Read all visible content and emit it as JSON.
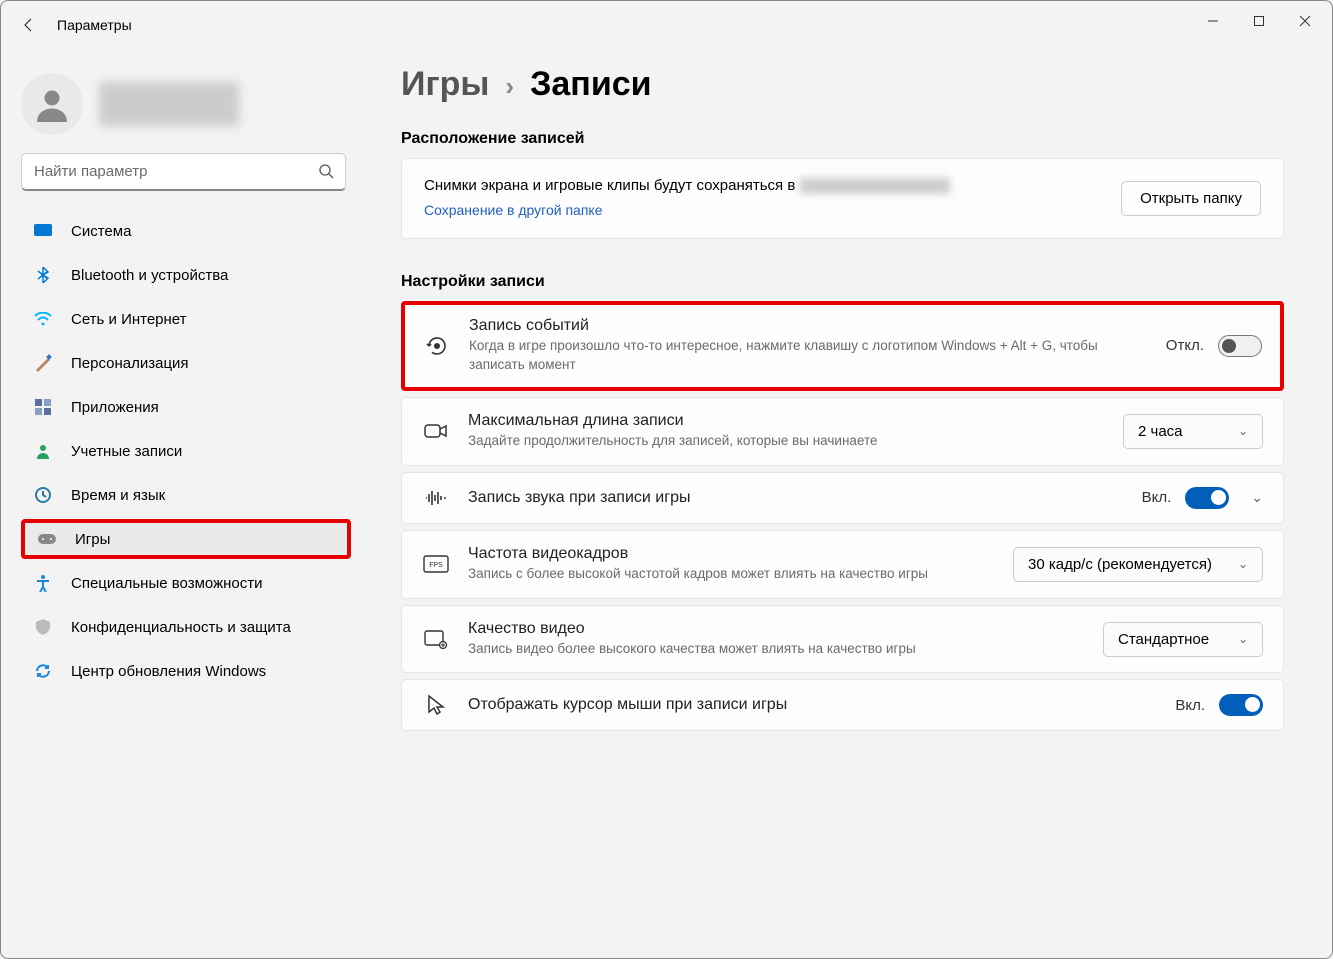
{
  "window": {
    "title": "Параметры"
  },
  "search": {
    "placeholder": "Найти параметр"
  },
  "nav": {
    "items": [
      {
        "label": "Система",
        "icon": "system",
        "color": "#0078d4"
      },
      {
        "label": "Bluetooth и устройства",
        "icon": "bluetooth",
        "color": "#0078d4"
      },
      {
        "label": "Сеть и Интернет",
        "icon": "wifi",
        "color": "#00b7ff"
      },
      {
        "label": "Персонализация",
        "icon": "brush",
        "color": "#c0825a"
      },
      {
        "label": "Приложения",
        "icon": "apps",
        "color": "#5a6fa0"
      },
      {
        "label": "Учетные записи",
        "icon": "account",
        "color": "#2aa060"
      },
      {
        "label": "Время и язык",
        "icon": "time",
        "color": "#2a80a0"
      },
      {
        "label": "Игры",
        "icon": "gaming",
        "color": "#888",
        "selected": true,
        "highlighted": true
      },
      {
        "label": "Специальные возможности",
        "icon": "accessibility",
        "color": "#1a88e0"
      },
      {
        "label": "Конфиденциальность и защита",
        "icon": "privacy",
        "color": "#888"
      },
      {
        "label": "Центр обновления Windows",
        "icon": "update",
        "color": "#1a88e0"
      }
    ]
  },
  "breadcrumb": {
    "parent": "Игры",
    "current": "Записи"
  },
  "sections": {
    "location_heading": "Расположение записей",
    "recording_heading": "Настройки записи"
  },
  "location": {
    "text": "Снимки экрана и игровые клипы будут сохраняться в",
    "link": "Сохранение в другой папке",
    "button": "Открыть папку"
  },
  "rows": {
    "capture": {
      "title": "Запись событий",
      "sub": "Когда в игре произошло что-то интересное, нажмите клавишу с логотипом Windows + Alt + G, чтобы записать момент",
      "state_label": "Откл.",
      "state": "off",
      "highlighted": true
    },
    "maxlen": {
      "title": "Максимальная длина записи",
      "sub": "Задайте продолжительность для записей, которые вы начинаете",
      "value": "2 часа"
    },
    "audio": {
      "title": "Запись звука при записи игры",
      "state_label": "Вкл.",
      "state": "on",
      "expandable": true
    },
    "fps": {
      "title": "Частота видеокадров",
      "sub": "Запись с более высокой частотой кадров может влиять на качество игры",
      "value": "30 кадр/с (рекомендуется)"
    },
    "quality": {
      "title": "Качество видео",
      "sub": "Запись видео более высокого качества может влиять на качество игры",
      "value": "Стандартное"
    },
    "cursor": {
      "title": "Отображать курсор мыши при записи игры",
      "state_label": "Вкл.",
      "state": "on"
    }
  }
}
